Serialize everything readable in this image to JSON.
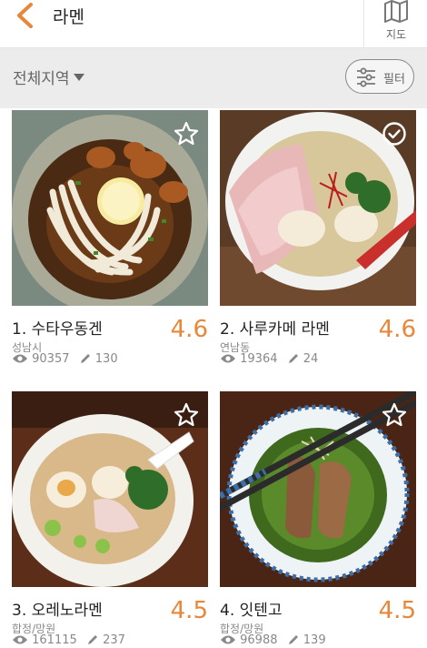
{
  "header": {
    "title": "라멘",
    "map_label": "지도"
  },
  "filterbar": {
    "region": "전체지역",
    "filter_label": "필터"
  },
  "restaurants": [
    {
      "name": "1. 수타우동겐",
      "rating": "4.6",
      "area": "성남시",
      "views": "90357",
      "reviews": "130",
      "favorited": false
    },
    {
      "name": "2. 사루카메 라멘",
      "rating": "4.6",
      "area": "연남동",
      "views": "19364",
      "reviews": "24",
      "favorited": true
    },
    {
      "name": "3. 오레노라멘",
      "rating": "4.5",
      "area": "합정/망원",
      "views": "161115",
      "reviews": "237",
      "favorited": false
    },
    {
      "name": "4. 잇텐고",
      "rating": "4.5",
      "area": "합정/망원",
      "views": "96988",
      "reviews": "139",
      "favorited": false
    }
  ],
  "colors": {
    "accent": "#e8873a",
    "filter_bg": "#ececec"
  }
}
